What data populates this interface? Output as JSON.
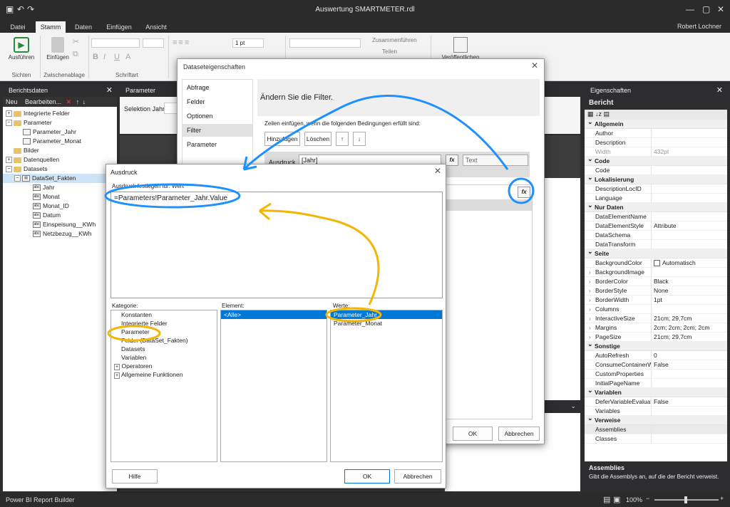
{
  "app": {
    "title": "Auswertung SMARTMETER.rdl",
    "user": "Robert Lochner",
    "status": "Power BI Report Builder",
    "zoom": "100%"
  },
  "menu_tabs": [
    "Datei",
    "Stamm",
    "Daten",
    "Einfügen",
    "Ansicht"
  ],
  "ribbon": {
    "run": "Ausführen",
    "paste": "Einfügen",
    "views": "Sichten",
    "clipboard": "Zwischenablage",
    "font": "Schriftart",
    "size": "1 pt",
    "merge": "Zusammenführen",
    "split": "Teilen",
    "publish": "Veröffentlichen"
  },
  "report_data": {
    "title": "Berichtsdaten",
    "toolbar_new": "Neu",
    "toolbar_edit": "Bearbeiten...",
    "items": [
      "Integrierte Felder",
      "Parameter",
      "Parameter_Jahr",
      "Parameter_Monat",
      "Bilder",
      "Datenquellen",
      "Datasets",
      "DataSet_Fakten",
      "Jahr",
      "Monat",
      "Monat_ID",
      "Datum",
      "Einspeisung__KWh",
      "Netzbezug__KWh"
    ]
  },
  "param_panel": {
    "title": "Parameter",
    "label": "Selektion Jahr"
  },
  "properties": {
    "title": "Eigenschaften",
    "object": "Bericht",
    "sections": {
      "allgemein": "Allgemein",
      "code": "Code",
      "lokal": "Lokalisierung",
      "nurdaten": "Nur Daten",
      "seite": "Seite",
      "sonstige": "Sonstige",
      "variablen": "Variablen",
      "verweise": "Verweise"
    },
    "rows": {
      "author": "Author",
      "description": "Description",
      "width": "Width",
      "width_v": "432pt",
      "code": "Code",
      "desc_loc": "DescriptionLocID",
      "language": "Language",
      "den": "DataElementName",
      "des": "DataElementStyle",
      "des_v": "Attribute",
      "dschema": "DataSchema",
      "dtrans": "DataTransform",
      "bgc": "BackgroundColor",
      "bgc_v": "Automatisch",
      "bgi": "BackgroundImage",
      "bc": "BorderColor",
      "bc_v": "Black",
      "bs": "BorderStyle",
      "bs_v": "None",
      "bw": "BorderWidth",
      "bw_v": "1pt",
      "cols": "Columns",
      "isz": "InteractiveSize",
      "isz_v": "21cm; 29,7cm",
      "mar": "Margins",
      "mar_v": "2cm; 2cm; 2cm; 2cm",
      "psz": "PageSize",
      "psz_v": "21cm; 29,7cm",
      "ar": "AutoRefresh",
      "ar_v": "0",
      "ccw": "ConsumeContainerWhitespace",
      "ccw_v": "False",
      "cp": "CustomProperties",
      "ipn": "InitialPageName",
      "dve": "DeferVariableEvaluation",
      "dve_v": "False",
      "vars": "Variables",
      "asm": "Assemblies",
      "cls": "Classes"
    },
    "help_title": "Assemblies",
    "help_text": "Gibt die Assemblys an, auf die der Bericht verweist."
  },
  "ds_dialog": {
    "title": "Dataseteigenschaften",
    "nav": [
      "Abfrage",
      "Felder",
      "Optionen",
      "Filter",
      "Parameter"
    ],
    "heading": "Ändern Sie die Filter.",
    "hint": "Zeilen einfügen, wenn die folgenden Bedingungen erfüllt sind:",
    "add": "Hinzufügen",
    "delete": "Löschen",
    "expr_label": "Ausdruck",
    "expr_value": "[Jahr]",
    "type": "Text",
    "ok": "OK",
    "cancel": "Abbrechen"
  },
  "expr_dialog": {
    "title": "Ausdruck",
    "subtitle": "Ausdruck festlegen für: Wert",
    "expression": "=Parameters!Parameter_Jahr.Value",
    "cat_label": "Kategorie:",
    "el_label": "Element:",
    "val_label": "Werte:",
    "categories": [
      "Konstanten",
      "Integrierte Felder",
      "Parameter",
      "Felder (DataSet_Fakten)",
      "Datasets",
      "Variablen",
      "Operatoren",
      "Allgemeine Funktionen"
    ],
    "elements": [
      "<Alle>"
    ],
    "values": [
      "Parameter_Jahr",
      "Parameter_Monat"
    ],
    "help": "Hilfe",
    "ok": "OK",
    "cancel": "Abbrechen"
  }
}
